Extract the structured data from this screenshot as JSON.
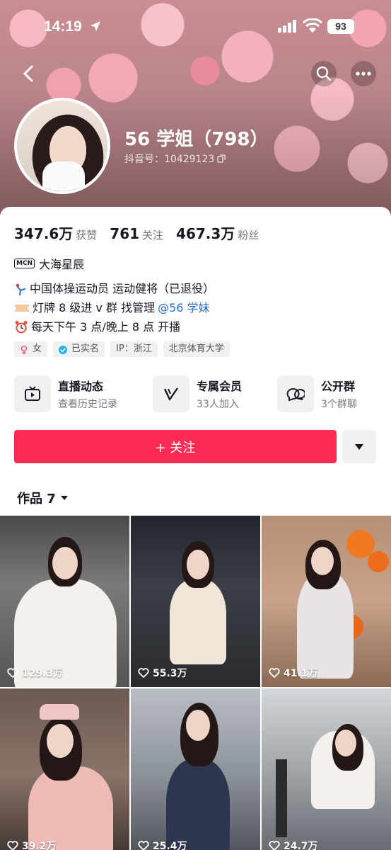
{
  "status_bar": {
    "time": "14:19",
    "battery": "93"
  },
  "profile": {
    "nickname": "56 学姐（798）",
    "douyin_id": "抖音号：10429123",
    "stats": [
      {
        "num": "347.6万",
        "label": "获赞"
      },
      {
        "num": "761",
        "label": "关注"
      },
      {
        "num": "467.3万",
        "label": "粉丝"
      }
    ],
    "mcn_badge": "MCN",
    "mcn_name": "大海星辰",
    "bio": {
      "line1": "中国体操运动员 运动健将（已退役）",
      "line2_prefix": "灯牌 8 级进 v 群 找管理",
      "line2_mention": "@56 学妹",
      "line3": "每天下午 3 点/晚上 8 点 开播"
    },
    "tags": [
      "女",
      "已实名",
      "IP：浙江",
      "北京体育大学"
    ]
  },
  "features": [
    {
      "title": "直播动态",
      "sub": "查看历史记录",
      "icon": "tv-icon"
    },
    {
      "title": "专属会员",
      "sub": "33人加入",
      "icon": "v-icon"
    },
    {
      "title": "公开群",
      "sub": "3个群聊",
      "icon": "chat-icon"
    }
  ],
  "actions": {
    "follow_label": "+ 关注"
  },
  "works": {
    "tab_label": "作品 7",
    "items": [
      {
        "likes": "129.3万"
      },
      {
        "likes": "55.3万"
      },
      {
        "likes": "41.1万"
      },
      {
        "likes": "39.2万"
      },
      {
        "likes": "25.4万"
      },
      {
        "likes": "24.7万"
      }
    ]
  },
  "colors": {
    "accent": "#fe2c55",
    "mention": "#2a6bd1"
  }
}
